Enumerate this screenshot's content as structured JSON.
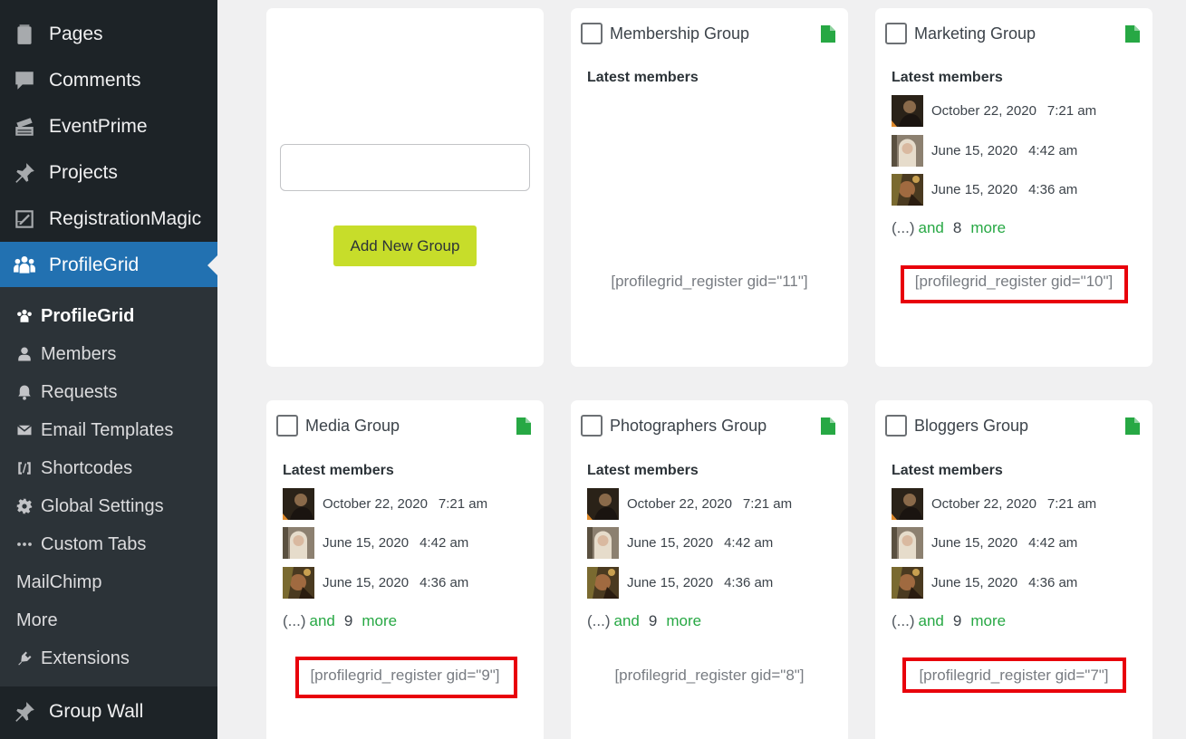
{
  "sidebar": {
    "items": [
      {
        "label": "Pages",
        "icon": "pages-icon"
      },
      {
        "label": "Comments",
        "icon": "comments-icon"
      },
      {
        "label": "EventPrime",
        "icon": "eventprime-icon"
      },
      {
        "label": "Projects",
        "icon": "pin-icon"
      },
      {
        "label": "RegistrationMagic",
        "icon": "registrationmagic-icon"
      },
      {
        "label": "ProfileGrid",
        "icon": "profilegrid-icon",
        "active": true
      },
      {
        "label": "Group Wall",
        "icon": "pin-icon"
      }
    ],
    "submenu": [
      {
        "label": "ProfileGrid",
        "icon": "profilegrid-small-icon",
        "current": true
      },
      {
        "label": "Members",
        "icon": "person-icon"
      },
      {
        "label": "Requests",
        "icon": "bell-icon"
      },
      {
        "label": "Email Templates",
        "icon": "envelope-icon"
      },
      {
        "label": "Shortcodes",
        "icon": "shortcode-icon"
      },
      {
        "label": "Global Settings",
        "icon": "gear-icon"
      },
      {
        "label": "Custom Tabs",
        "icon": "dots-icon"
      },
      {
        "label": "MailChimp",
        "icon": ""
      },
      {
        "label": "More",
        "icon": ""
      },
      {
        "label": "Extensions",
        "icon": "plug-icon"
      }
    ]
  },
  "add_group": {
    "input_value": "",
    "button_label": "Add New Group"
  },
  "labels": {
    "latest_members": "Latest members",
    "ellipsis": "(...)",
    "and": "and",
    "more": "more"
  },
  "groups": [
    {
      "title": "Membership Group",
      "members": [],
      "more_count": "",
      "shortcode": "[profilegrid_register gid=\"11\"]",
      "highlighted": false
    },
    {
      "title": "Marketing Group",
      "members": [
        {
          "date": "October 22, 2020",
          "time": "7:21 am"
        },
        {
          "date": "June 15, 2020",
          "time": "4:42 am"
        },
        {
          "date": "June 15, 2020",
          "time": "4:36 am"
        }
      ],
      "more_count": "8",
      "shortcode": "[profilegrid_register gid=\"10\"]",
      "highlighted": true
    },
    {
      "title": "Media Group",
      "members": [
        {
          "date": "October 22, 2020",
          "time": "7:21 am"
        },
        {
          "date": "June 15, 2020",
          "time": "4:42 am"
        },
        {
          "date": "June 15, 2020",
          "time": "4:36 am"
        }
      ],
      "more_count": "9",
      "shortcode": "[profilegrid_register gid=\"9\"]",
      "highlighted": true
    },
    {
      "title": "Photographers Group",
      "members": [
        {
          "date": "October 22, 2020",
          "time": "7:21 am"
        },
        {
          "date": "June 15, 2020",
          "time": "4:42 am"
        },
        {
          "date": "June 15, 2020",
          "time": "4:36 am"
        }
      ],
      "more_count": "9",
      "shortcode": "[profilegrid_register gid=\"8\"]",
      "highlighted": false
    },
    {
      "title": "Bloggers Group",
      "members": [
        {
          "date": "October 22, 2020",
          "time": "7:21 am"
        },
        {
          "date": "June 15, 2020",
          "time": "4:42 am"
        },
        {
          "date": "June 15, 2020",
          "time": "4:36 am"
        }
      ],
      "more_count": "9",
      "shortcode": "[profilegrid_register gid=\"7\"]",
      "highlighted": true
    }
  ],
  "colors": {
    "sidebar_bg": "#1d2327",
    "submenu_bg": "#2c3338",
    "active_blue": "#2271b1",
    "add_button": "#c7dd2a",
    "green_link": "#27a844",
    "highlight_red": "#e8000b"
  }
}
